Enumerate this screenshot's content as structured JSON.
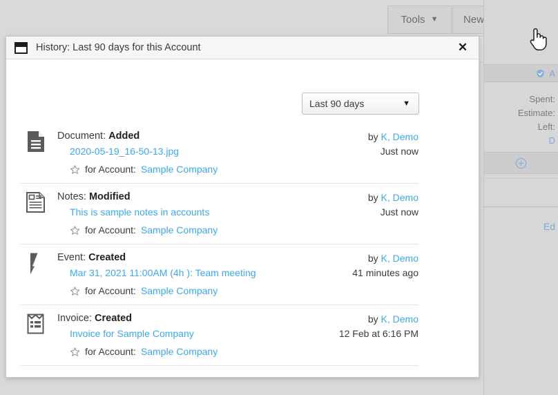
{
  "background": {
    "toolbar": {
      "tools_label": "Tools",
      "new_label": "New",
      "caret_glyph": "▼"
    },
    "right_panel": {
      "header_label": "A",
      "stats": [
        "Spent:",
        "Estimate:",
        "Left:",
        "D"
      ],
      "edit_label": "Ed"
    }
  },
  "dialog": {
    "title": "History: Last 90 days for this Account",
    "close_label": "✕",
    "filter": {
      "selected": "Last 90 days",
      "caret_glyph": "▼",
      "options": [
        "Last 90 days"
      ]
    },
    "labels": {
      "by_prefix": "by ",
      "for_account_prefix": "for Account:"
    },
    "entries": [
      {
        "icon": "document-icon",
        "type": "Document:",
        "action": "Added",
        "link": "2020-05-19_16-50-13.jpg",
        "account": "Sample Company",
        "author": "K, Demo",
        "time": "Just now"
      },
      {
        "icon": "notes-icon",
        "type": "Notes:",
        "action": "Modified",
        "link": "This is sample notes in accounts",
        "account": "Sample Company",
        "author": "K, Demo",
        "time": "Just now"
      },
      {
        "icon": "event-bolt-icon",
        "type": "Event:",
        "action": "Created",
        "link": "Mar 31, 2021 11:00AM (4h ): Team meeting",
        "account": "Sample Company",
        "author": "K, Demo",
        "time": "41 minutes ago"
      },
      {
        "icon": "invoice-icon",
        "type": "Invoice:",
        "action": "Created",
        "link": "Invoice for Sample Company",
        "account": "Sample Company",
        "author": "K, Demo",
        "time": "12 Feb at 6:16 PM"
      }
    ]
  },
  "colors": {
    "link": "#3aa9e8",
    "accent_blue": "#7fa8d8",
    "panel_bg": "#d7d7d7",
    "dialog_title_bg": "#f6f6f6"
  }
}
